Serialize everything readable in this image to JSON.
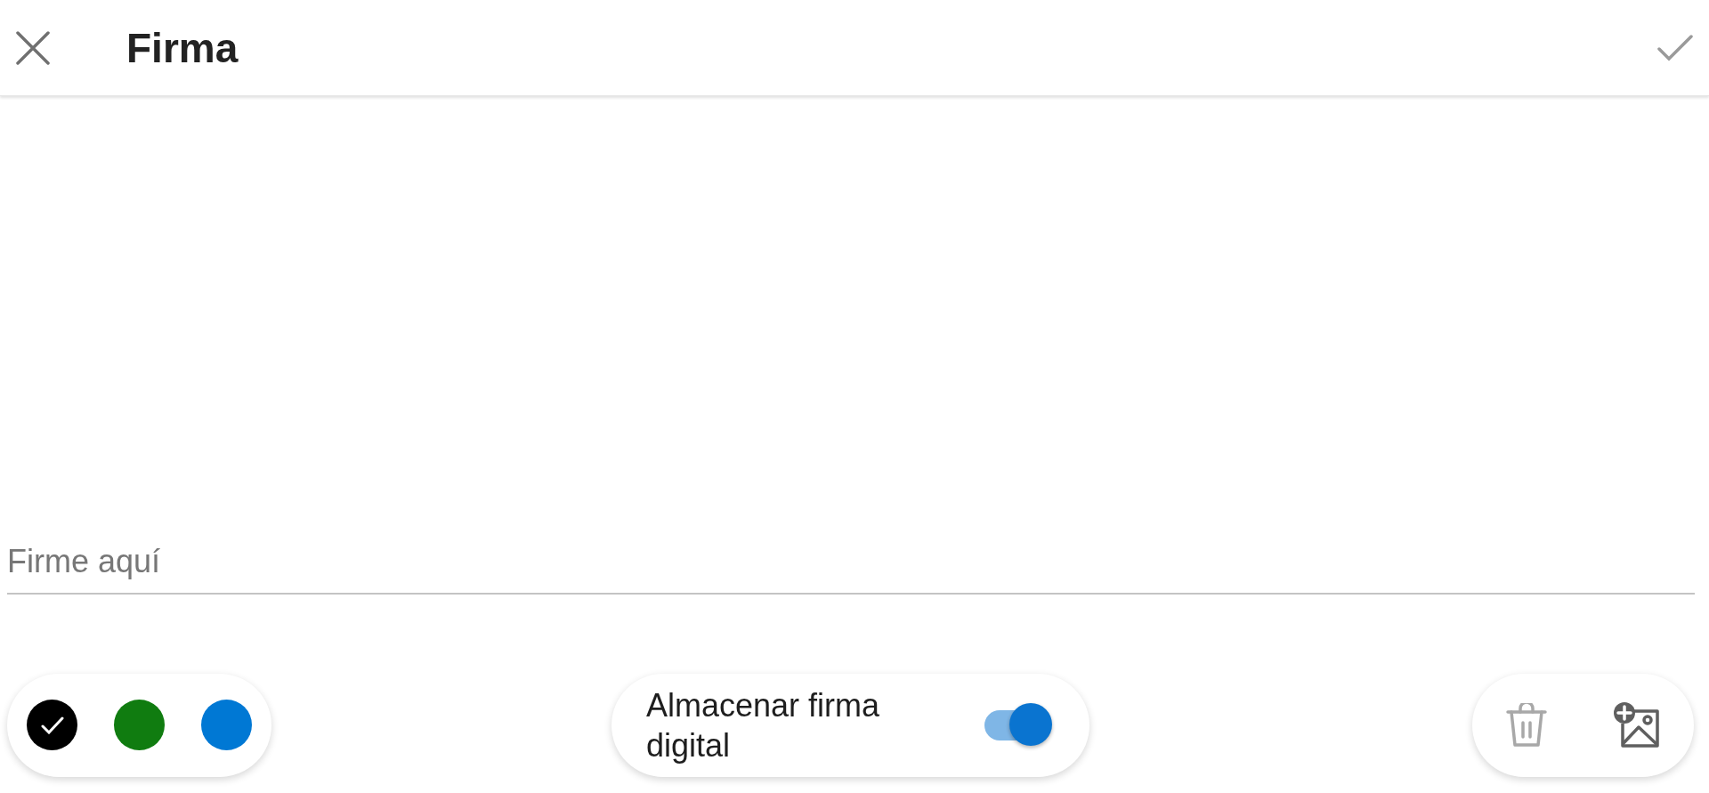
{
  "header": {
    "title": "Firma",
    "confirm": {
      "disabled": true
    }
  },
  "signature": {
    "placeholder": "Firme aquí"
  },
  "colors": [
    {
      "color": "#000000",
      "selected": true
    },
    {
      "color": "#107c10",
      "selected": false
    },
    {
      "color": "#0078d4",
      "selected": false
    }
  ],
  "store_toggle": {
    "label": "Almacenar firma digital",
    "on": true
  },
  "actions": [
    {
      "kind": "delete",
      "disabled": true
    },
    {
      "kind": "add_image",
      "disabled": false
    }
  ]
}
